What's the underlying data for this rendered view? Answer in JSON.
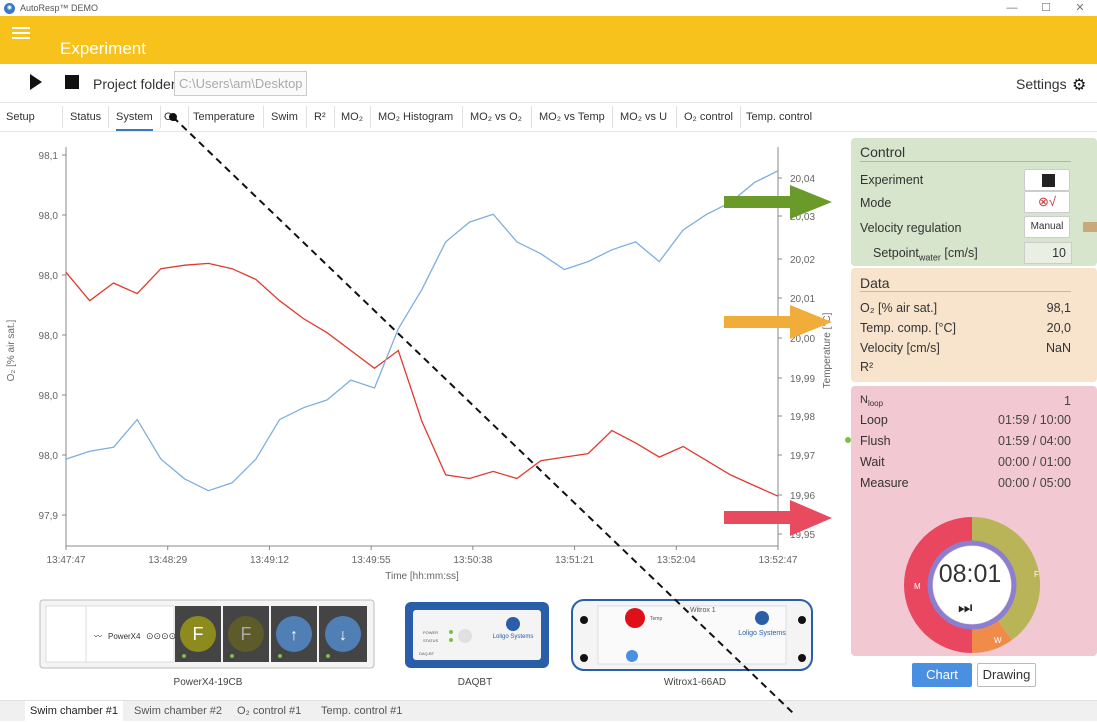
{
  "window": {
    "title": "AutoResp™ DEMO",
    "minimize": "—",
    "maximize": "☐",
    "close": "✕"
  },
  "appbar": {
    "title": "Experiment"
  },
  "toolbar": {
    "project_label": "Project folder",
    "project_value": "C:\\Users\\am\\Desktop",
    "settings_label": "Settings"
  },
  "tabs": [
    "Setup",
    "Status",
    "System",
    "O₂",
    "Temperature",
    "Swim",
    "R²",
    "MO₂",
    "MO₂ Histogram",
    "MO₂ vs O₂",
    "MO₂ vs Temp",
    "MO₂ vs U",
    "O₂ control",
    "Temp. control"
  ],
  "control": {
    "title": "Control",
    "experiment_label": "Experiment",
    "mode_label": "Mode",
    "mode_icon": "⊗√",
    "velocity_label": "Velocity regulation",
    "velocity_value": "Manual",
    "setpoint_label": "Setpoint",
    "setpoint_sub": "water",
    "setpoint_unit": " [cm/s]",
    "setpoint_value": "10"
  },
  "datapanel": {
    "title": "Data",
    "o2_label": "O₂ [% air sat.]",
    "o2_value": "98,1",
    "temp_label": "Temp. comp. [°C]",
    "temp_value": "20,0",
    "vel_label": "Velocity [cm/s]",
    "vel_value": "NaN",
    "r2_label": "R²"
  },
  "timer": {
    "nloop_label": "N",
    "nloop_sub": "loop",
    "nloop_value": "1",
    "loop_label": "Loop",
    "loop_value": "01:59 / 10:00",
    "flush_label": "Flush",
    "flush_value": "01:59 / 04:00",
    "wait_label": "Wait",
    "wait_value": "00:00 / 01:00",
    "measure_label": "Measure",
    "measure_value": "00:00 / 05:00",
    "clock": "08:01",
    "next_icon": "⏭",
    "seg_m": "M",
    "seg_f": "F",
    "seg_w": "W",
    "colors": {
      "measure": "#e8475f",
      "flush": "#b9b457",
      "wait": "#ef8c4a",
      "inner": "#8a7fd1"
    },
    "segments": [
      {
        "label": "M",
        "minutes": 5
      },
      {
        "label": "F",
        "minutes": 4
      },
      {
        "label": "W",
        "minutes": 1
      }
    ],
    "progress_fraction": 0.2
  },
  "view_buttons": {
    "chart": "Chart",
    "drawing": "Drawing"
  },
  "devices": [
    {
      "name": "PowerX4-19CB",
      "brand": "PowerX4",
      "buttons": [
        "F",
        "F",
        "↑",
        "↓"
      ]
    },
    {
      "name": "DAQBT",
      "brand": "Loligo Systems",
      "leds": [
        "POWER",
        "STATUS"
      ],
      "model": "DAQ-BT"
    },
    {
      "name": "Witrox1-66AD",
      "brand": "Loligo Systems",
      "model": "Witrox 1",
      "sensor": "Temp"
    }
  ],
  "bottom_tabs": [
    "Swim chamber #1",
    "Swim chamber #2",
    "O₂ control #1",
    "Temp. control #1"
  ],
  "colors": {
    "accent": "#f8c21c",
    "o2_line": "#e03a2e",
    "temp_line": "#7eaee0",
    "arrow_green": "#6a9a2a",
    "arrow_orange": "#f0ad3a",
    "arrow_red": "#e84a5f"
  },
  "chart_data": {
    "type": "line",
    "xlabel": "Time [hh:mm:ss]",
    "ylabel": "O₂ [% air sat.]",
    "y2label": "Temperature [°C]",
    "x_ticks": [
      "13:47:47",
      "13:48:29",
      "13:49:12",
      "13:49:55",
      "13:50:38",
      "13:51:21",
      "13:52:04",
      "13:52:47"
    ],
    "y_ticks": [
      "98,1",
      "98,0",
      "98,0",
      "98,0",
      "98,0",
      "98,0",
      "97,9"
    ],
    "y2_ticks": [
      "20,04",
      "20,03",
      "20,02",
      "20,01",
      "20,00",
      "19,99",
      "19,98",
      "19,97",
      "19,96",
      "19,95"
    ],
    "y_range": [
      97.88,
      98.1
    ],
    "y2_range": [
      19.948,
      20.047
    ],
    "x_range_seconds": [
      0,
      300
    ],
    "grid": false,
    "series": [
      {
        "name": "O₂",
        "axis": "left",
        "color": "#e03a2e",
        "x": [
          0,
          10,
          20,
          30,
          40,
          50,
          60,
          70,
          80,
          90,
          100,
          110,
          120,
          130,
          140,
          150,
          160,
          170,
          180,
          190,
          200,
          210,
          220,
          230,
          240,
          250,
          260,
          270,
          280,
          290,
          300
        ],
        "y": [
          98.034,
          98.018,
          98.028,
          98.022,
          98.036,
          98.038,
          98.039,
          98.036,
          98.03,
          98.018,
          98.008,
          98.0,
          97.99,
          97.98,
          97.99,
          97.95,
          97.92,
          97.918,
          97.922,
          97.918,
          97.928,
          97.93,
          97.932,
          97.945,
          97.938,
          97.93,
          97.936,
          97.928,
          97.92,
          97.914,
          97.908
        ]
      },
      {
        "name": "Temperature",
        "axis": "right",
        "color": "#7eaee0",
        "x": [
          0,
          10,
          20,
          30,
          40,
          50,
          60,
          70,
          80,
          90,
          100,
          110,
          120,
          130,
          140,
          150,
          160,
          170,
          180,
          190,
          200,
          210,
          220,
          230,
          240,
          250,
          260,
          270,
          280,
          290,
          300
        ],
        "y": [
          19.97,
          19.972,
          19.973,
          19.98,
          19.97,
          19.965,
          19.962,
          19.964,
          19.97,
          19.98,
          19.983,
          19.985,
          19.99,
          19.988,
          20.003,
          20.013,
          20.025,
          20.03,
          20.032,
          20.025,
          20.022,
          20.018,
          20.02,
          20.023,
          20.025,
          20.02,
          20.028,
          20.032,
          20.035,
          20.04,
          20.043
        ]
      }
    ]
  }
}
